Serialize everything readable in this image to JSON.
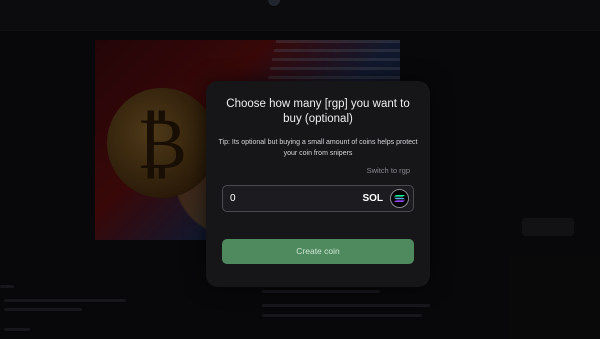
{
  "modal": {
    "title": "Choose how many [rgp] you want to buy (optional)",
    "tip": "Tip: Its optional but buying a small amount of coins helps protect your coin from snipers",
    "switch_link": "Switch to rgp",
    "amount_value": "0",
    "currency": "SOL",
    "currency_icon": "solana-icon",
    "create_button": "Create coin"
  },
  "colors": {
    "modal_bg": "#161619",
    "create_button_bg": "#4e8a5e",
    "page_bg": "#0b0b0d"
  }
}
